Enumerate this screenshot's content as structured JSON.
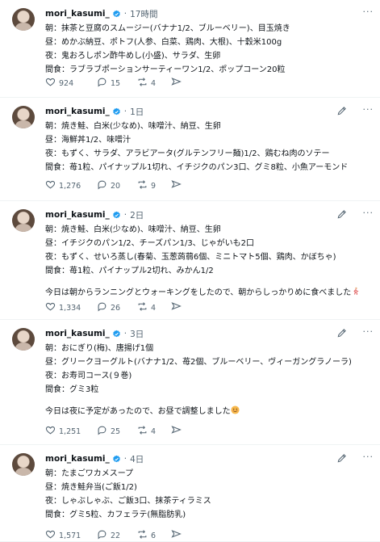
{
  "posts": [
    {
      "username": "mori_kasumi_",
      "time": "17時間",
      "lines": [
        "朝：抹茶と豆腐のスムージー(バナナ1/2、ブルーベリー)、目玉焼き",
        "昼：めかぶ納豆、ポトフ(人参、白菜、鶏肉、大根)、十穀米100g",
        "夜：鬼おろしポン酢牛めし(小盛)、サラダ、生卵",
        "間食：ラブラブポーションサーティーワン1/2、ポップコーン20粒"
      ],
      "note": "",
      "likes": "924",
      "replies": "15",
      "reposts": "4"
    },
    {
      "username": "mori_kasumi_",
      "time": "1日",
      "lines": [
        "朝：焼き鮭、白米(少なめ)、味噌汁、納豆、生卵",
        "昼：海鮮丼1/2、味噌汁",
        "夜：もずく、サラダ、アラビアータ(グルテンフリー麺)1/2、鶏むね肉のソテー",
        "間食：苺1粒、パイナップル1切れ、イチジクのパン3口、グミ8粒、小魚アーモンド"
      ],
      "note": "",
      "likes": "1,276",
      "replies": "20",
      "reposts": "9"
    },
    {
      "username": "mori_kasumi_",
      "time": "2日",
      "lines": [
        "朝：焼き鮭、白米(少なめ)、味噌汁、納豆、生卵",
        "昼：イチジクのパン1/2、チーズパン1/3、じゃがいも2口",
        "夜：もずく、せいろ蒸し(春菊、玉葱蒟蒻6個、ミニトマト5個、鶏肉、かぼちゃ)",
        "間食：苺1粒、パイナップル2切れ、みかん1/2"
      ],
      "note": "今日は朝からランニングとウォーキングをしたので、朝からしっかりめに食べました",
      "likes": "1,334",
      "replies": "26",
      "reposts": "4"
    },
    {
      "username": "mori_kasumi_",
      "time": "3日",
      "lines": [
        "朝：おにぎり(梅)、唐揚げ1個",
        "昼：グリークヨーグルト(バナナ1/2、苺2個、ブルーベリー、ヴィーガングラノーラ)",
        "夜：お寿司コース(９巻)",
        "間食：グミ3粒"
      ],
      "note": "今日は夜に予定があったので、お昼で調整しました",
      "likes": "1,251",
      "replies": "25",
      "reposts": "4"
    },
    {
      "username": "mori_kasumi_",
      "time": "4日",
      "lines": [
        "朝：たまごワカメスープ",
        "昼：焼き鮭弁当(ご飯1/2)",
        "夜：しゃぶしゃぶ、ご飯3口、抹茶ティラミス",
        "間食：グミ5粒、カフェラテ(無脂肪乳)"
      ],
      "note": "",
      "likes": "1,571",
      "replies": "22",
      "reposts": "6"
    }
  ],
  "icons": {
    "verified": "verified-badge-icon",
    "edit": "pencil-edit-icon",
    "more": "more-dots-icon",
    "like": "heart-icon",
    "reply": "reply-bubble-icon",
    "repost": "repost-arrows-icon",
    "share": "share-send-icon"
  },
  "colors": {
    "verified": "#1d9bf0",
    "muted": "#536471",
    "text": "#0f1419",
    "divider": "#eff3f4"
  }
}
